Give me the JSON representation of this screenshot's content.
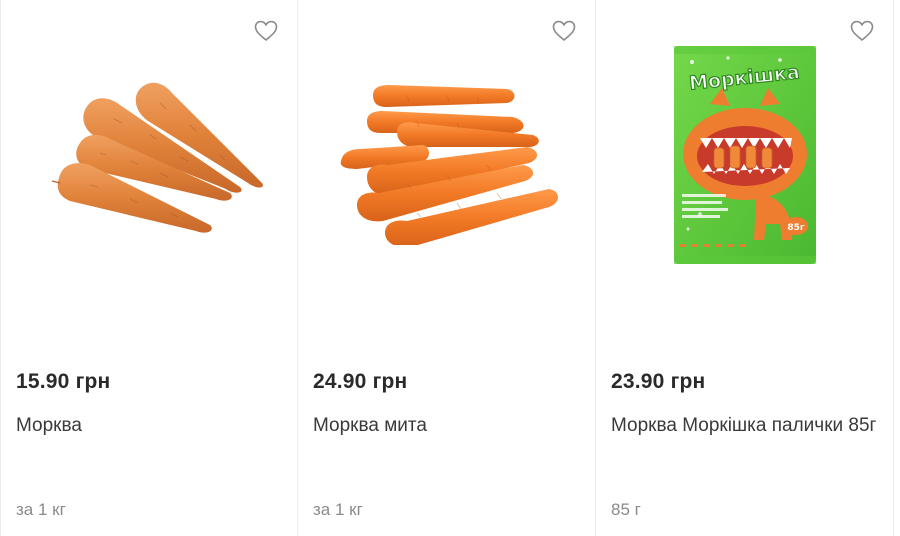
{
  "products": [
    {
      "price": "15.90 грн",
      "name": "Морква",
      "unit": "за 1 кг",
      "image": "loose-carrots",
      "favorite_icon": "heart-outline-icon"
    },
    {
      "price": "24.90 грн",
      "name": "Морква мита",
      "unit": "за 1 кг",
      "image": "washed-carrots",
      "favorite_icon": "heart-outline-icon"
    },
    {
      "price": "23.90 грн",
      "name": "Морква Моркішка палички 85г",
      "unit": "85 г",
      "image": "carrot-sticks-package",
      "package_brand": "Моркішка",
      "package_weight": "85г",
      "favorite_icon": "heart-outline-icon"
    }
  ],
  "colors": {
    "carrot": "#e8863c",
    "package_green": "#5cc83a",
    "heart_stroke": "#8a8a8a"
  }
}
